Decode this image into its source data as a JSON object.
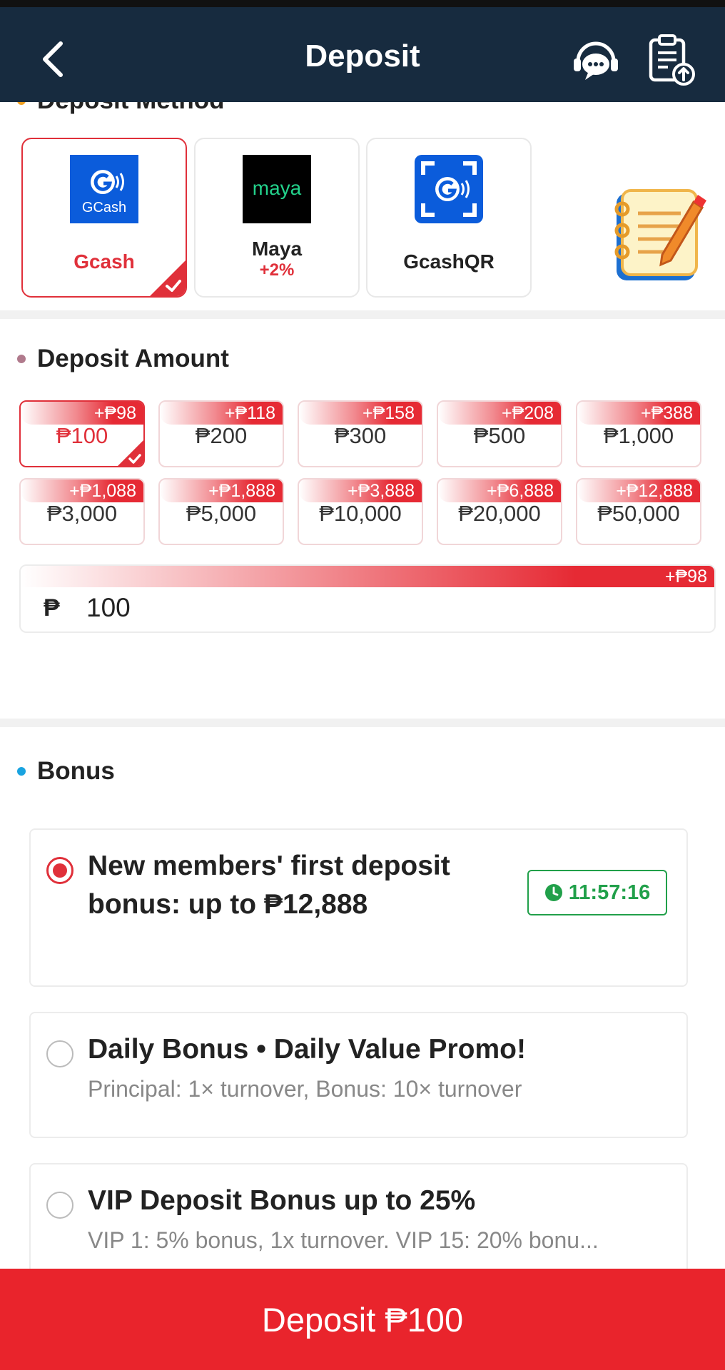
{
  "header": {
    "title": "Deposit"
  },
  "deposit_method": {
    "label": "Deposit Method",
    "methods": [
      {
        "name": "Gcash",
        "logo_text": "GCash",
        "bonus": "",
        "selected": true,
        "name_color": "#e0303a"
      },
      {
        "name": "Maya",
        "logo_text": "maya",
        "bonus": "+2%",
        "selected": false,
        "name_color": "#222222"
      },
      {
        "name": "GcashQR",
        "logo_text": "",
        "bonus": "",
        "selected": false,
        "name_color": "#222222"
      }
    ]
  },
  "deposit_amount": {
    "label": "Deposit Amount",
    "options": [
      {
        "value": "₱100",
        "bonus": "+₱98",
        "selected": true
      },
      {
        "value": "₱200",
        "bonus": "+₱118"
      },
      {
        "value": "₱300",
        "bonus": "+₱158"
      },
      {
        "value": "₱500",
        "bonus": "+₱208"
      },
      {
        "value": "₱1,000",
        "bonus": "+₱388"
      },
      {
        "value": "₱3,000",
        "bonus": "+₱1,088"
      },
      {
        "value": "₱5,000",
        "bonus": "+₱1,888"
      },
      {
        "value": "₱10,000",
        "bonus": "+₱3,888"
      },
      {
        "value": "₱20,000",
        "bonus": "+₱6,888"
      },
      {
        "value": "₱50,000",
        "bonus": "+₱12,888"
      }
    ],
    "input": {
      "currency": "₱",
      "value": "100",
      "bonus": "+₱98"
    }
  },
  "bonus": {
    "label": "Bonus",
    "items": [
      {
        "title": "New members' first deposit bonus: up to ₱12,888",
        "desc": "",
        "timer": "11:57:16",
        "selected": true
      },
      {
        "title": "Daily Bonus • Daily Value Promo!",
        "desc": "Principal: 1× turnover, Bonus: 10× turnover",
        "selected": false
      },
      {
        "title": "VIP Deposit Bonus up to 25%",
        "desc": "VIP 1: 5% bonus, 1x turnover. VIP 15: 20% bonu...",
        "selected": false
      }
    ]
  },
  "footer": {
    "deposit_label": "Deposit ₱100"
  },
  "colors": {
    "header_bg": "#172b3f",
    "accent_red": "#e9242c",
    "timer_green": "#21a04a"
  }
}
